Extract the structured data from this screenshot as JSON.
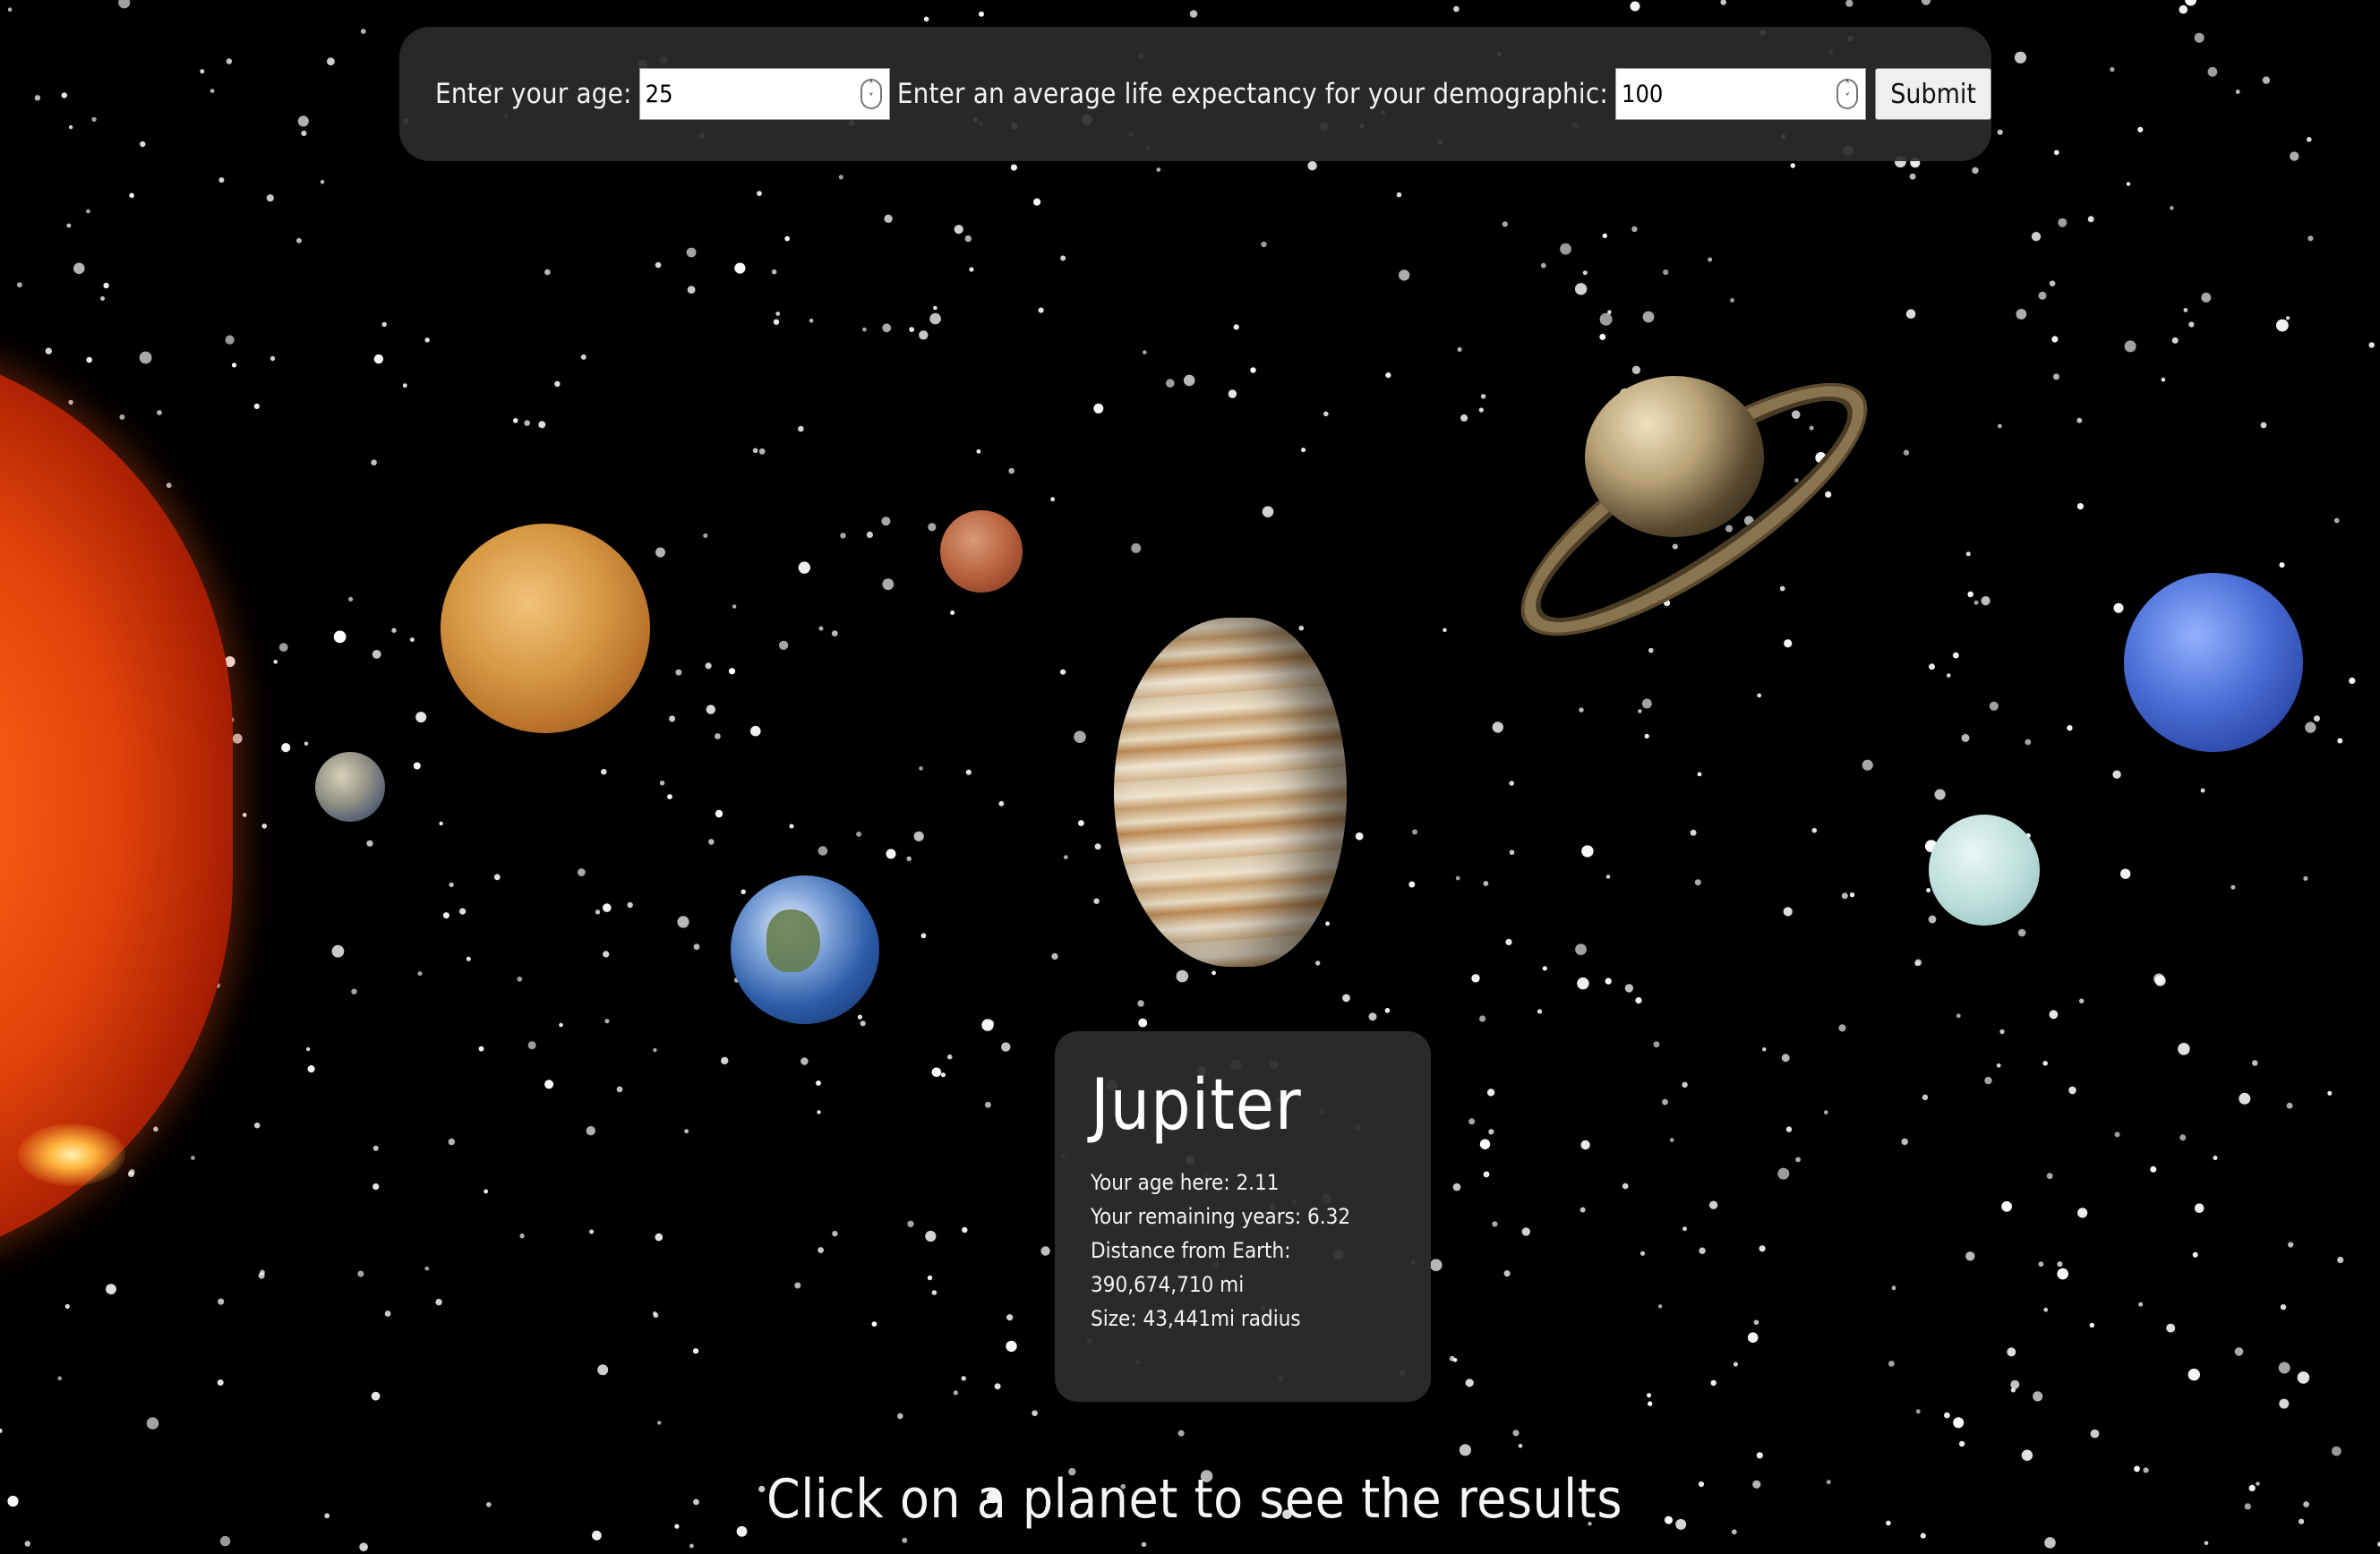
{
  "form": {
    "age_label": "Enter your age:",
    "age_value": "25",
    "life_label": "Enter an average life expectancy for your demographic:",
    "life_value": "100",
    "submit_label": "Submit"
  },
  "planets": [
    {
      "name": "sun"
    },
    {
      "name": "mercury"
    },
    {
      "name": "venus"
    },
    {
      "name": "earth"
    },
    {
      "name": "mars"
    },
    {
      "name": "jupiter"
    },
    {
      "name": "saturn"
    },
    {
      "name": "uranus"
    },
    {
      "name": "neptune"
    }
  ],
  "result": {
    "planet": "Jupiter",
    "age_here": "Your age here: 2.11",
    "remaining": "Your remaining years: 6.32",
    "distance_label": "Distance from Earth:",
    "distance_value": "390,674,710 mi",
    "size": "Size: 43,441mi radius"
  },
  "footer": {
    "instruction": "Click on a planet to see the results"
  },
  "colors": {
    "background": "#000000",
    "panel": "#2b2b2b",
    "text": "#ffffff"
  }
}
